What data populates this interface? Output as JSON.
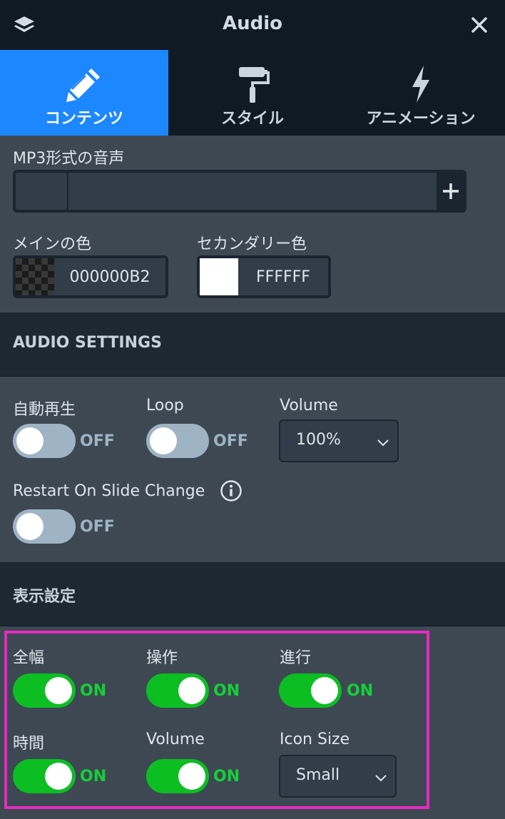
{
  "header": {
    "title": "Audio"
  },
  "tabs": [
    {
      "label": "コンテンツ",
      "icon": "pencil-icon",
      "active": true
    },
    {
      "label": "スタイル",
      "icon": "paint-roller-icon",
      "active": false
    },
    {
      "label": "アニメーション",
      "icon": "lightning-icon",
      "active": false
    }
  ],
  "content": {
    "mp3_label": "MP3形式の音声",
    "mp3_value": "",
    "main_color_label": "メインの色",
    "main_color_hex": "000000B2",
    "secondary_color_label": "セカンダリー色",
    "secondary_color_hex": "FFFFFF"
  },
  "audio_settings": {
    "title": "AUDIO SETTINGS",
    "autoplay": {
      "label": "自動再生",
      "state": "OFF"
    },
    "loop": {
      "label": "Loop",
      "state": "OFF"
    },
    "volume": {
      "label": "Volume",
      "value": "100%"
    },
    "restart": {
      "label": "Restart On Slide Change",
      "state": "OFF"
    }
  },
  "display_settings": {
    "title": "表示設定",
    "fullwidth": {
      "label": "全幅",
      "state": "ON"
    },
    "controls": {
      "label": "操作",
      "state": "ON"
    },
    "progress": {
      "label": "進行",
      "state": "ON"
    },
    "time": {
      "label": "時間",
      "state": "ON"
    },
    "volume": {
      "label": "Volume",
      "state": "ON"
    },
    "icon_size": {
      "label": "Icon Size",
      "value": "Small"
    }
  },
  "colors": {
    "accent": "#1d87ff",
    "toggle_on": "#0cbe22",
    "toggle_off": "#9eb4c5",
    "highlight": "#e52bbf"
  }
}
